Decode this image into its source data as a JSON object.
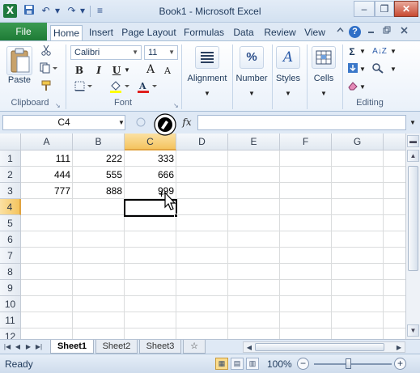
{
  "window": {
    "title": "Book1 - Microsoft Excel",
    "logo_glyph": "X",
    "minimize": "–",
    "restore": "❐",
    "close": "✕"
  },
  "qat": {
    "save_glyph": "💾",
    "undo_glyph": "↶",
    "redo_glyph": "↷",
    "dropdown_glyph": "▾",
    "customize_glyph": "≡"
  },
  "tabs": {
    "file": "File",
    "items": [
      "Home",
      "Insert",
      "Page Layout",
      "Formulas",
      "Data",
      "Review",
      "View"
    ],
    "active": "Home",
    "help_glyph": "?"
  },
  "ribbon": {
    "clipboard": {
      "label": "Clipboard",
      "paste": "Paste",
      "launcher": "↘"
    },
    "font": {
      "label": "Font",
      "name": "Calibri",
      "size": "11",
      "bold": "B",
      "italic": "I",
      "underline": "U",
      "grow": "A",
      "shrink": "A",
      "launcher": "↘",
      "fill_color": "#ffff00",
      "font_color": "#e0201e"
    },
    "alignment": {
      "label": "Alignment"
    },
    "number": {
      "label": "Number",
      "glyph": "%"
    },
    "styles": {
      "label": "Styles",
      "glyph": "A"
    },
    "cells": {
      "label": "Cells"
    },
    "editing": {
      "label": "Editing",
      "sum_glyph": "Σ",
      "sort_glyph": "A↓Z"
    }
  },
  "formula_bar": {
    "name_box": "C4",
    "fx": "fx",
    "value": ""
  },
  "sheet": {
    "columns": [
      "A",
      "B",
      "C",
      "D",
      "E",
      "F",
      "G"
    ],
    "rows": [
      "1",
      "2",
      "3",
      "4",
      "5",
      "6",
      "7",
      "8",
      "9",
      "10",
      "11",
      "12"
    ],
    "selected_cell": "C4",
    "cells": {
      "A1": "111",
      "B1": "222",
      "C1": "333",
      "A2": "444",
      "B2": "555",
      "C2": "666",
      "A3": "777",
      "B3": "888",
      "C3": "999"
    }
  },
  "sheet_tabs": {
    "items": [
      "Sheet1",
      "Sheet2",
      "Sheet3"
    ],
    "active": "Sheet1",
    "insert_glyph": "☆"
  },
  "status": {
    "ready": "Ready",
    "zoom": "100%",
    "zoom_minus": "−",
    "zoom_plus": "+"
  },
  "colors": {
    "file_tab": "#1e7b36",
    "selected_header": "#f4c45f"
  }
}
